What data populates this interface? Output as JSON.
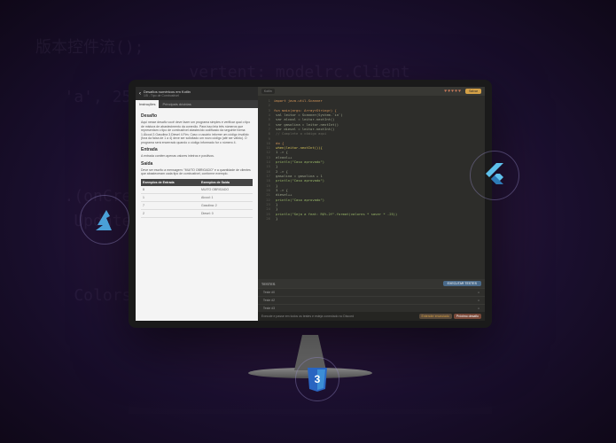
{
  "bg_code_lines": "版本控件流();\n                vertent: modelrc.Client\n   'a', 255; (fs).readFileSyn\n          constructor(op\n\n                               (varian\n   .(onCreath,\n    Updates{filepath()         ).discon\n\n                              window.on\n    Colors(v",
  "header": {
    "title": "Desafios numéricos em Kotlin",
    "subtitle": "1/5 - Tipo de Combustível"
  },
  "tabs": {
    "tab1": "Instruções",
    "tab2": "Principais dúvidas"
  },
  "challenge": {
    "desafio_h": "Desafio",
    "desafio_p": "Aqui nesse desafio você deve fazer um programa simples e verificar qual o tipo de mistura de abastecimento da conexão. Para isso leia três números que representam o tipo de combustível abastecido codificado da seguinte forma: 1.Álcool 2.Gasolina 3.Diesel 4.Fim. Caso o usuário informe um código inválido (fora da faixa de 1 a 4) deve ser solicitado um novo código (até ser válido). O programa será encerrado quando o código informado for o número 4.",
    "entrada_h": "Entrada",
    "entrada_p": "A entrada contém apenas valores inteiros e positivos.",
    "saida_h": "Saída",
    "saida_p": "Deve ser escrito a mensagem: \"MUITO OBRIGADO\" e a quantidade de clientes que abasteceram cada tipo de combustível, conforme exemplo."
  },
  "io": {
    "col1": "Exemplos de Entrada",
    "col2": "Exemplos de Saída",
    "r1c1": "8",
    "r1c2": "MUITO OBRIGADO",
    "r2c1": "1",
    "r2c2": "Alcool: 1",
    "r3c1": "7",
    "r3c2": "Gasolina: 2",
    "r4c1": "2",
    "r4c2": "Diesel: 0"
  },
  "toolbar": {
    "breadcrumb": "Kotlin",
    "run": "Salvar"
  },
  "code": {
    "l1": "import java.util.Scanner",
    "l2": "fun main(args: Array<String>) {",
    "l3": "  val leitor = Scanner(System.`in`)",
    "l4": "  var alcool = leitor.nextInt()",
    "l5": "  var gasolina = leitor.nextInt()",
    "l6": "  var diesel = leitor.nextInt()",
    "l7": "  // Complete o código aqui",
    "l8": "  do {",
    "l9": "    when(leitor.nextInt()){",
    "l10": "      1 -> {",
    "l11": "        alcool++",
    "l12": "        println(\"Caso aprovado\")",
    "l13": "      }",
    "l14": "      2 -> {",
    "l15": "        gasolina = gasolina + 1",
    "l16": "        println(\"Caso aprovado\")",
    "l17": "      }",
    "l18": "      3 -> {",
    "l19": "        diesel++",
    "l20": "        println(\"Caso aprovado\")",
    "l21": "      }",
    "l22": "    }",
    "l23": "    println(\"Seja a feat: R$%.2f\".format(valores * saver * .25))",
    "l24": "  }"
  },
  "tests": {
    "header": "TESTES",
    "exec": "EXECUTAR TESTES",
    "t1": "Teste #0",
    "t2": "Teste #2",
    "t3": "Teste #3"
  },
  "bottom": {
    "msg": "Execute e passe em todos os testes e esteja conectado no Discord",
    "btn1": "Entender enunciado",
    "btn2": "Próximo desafio"
  },
  "badges": {
    "azure": "azure-icon",
    "flutter": "flutter-icon",
    "css": "css3-icon"
  }
}
